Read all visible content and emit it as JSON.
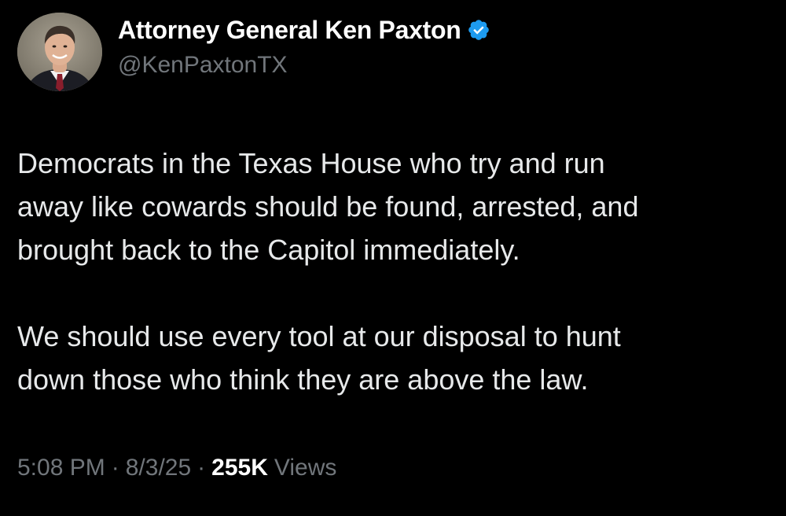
{
  "author": {
    "display_name": "Attorney General Ken Paxton",
    "handle": "@KenPaxtonTX",
    "verified": true,
    "verified_color": "#1d9bf0",
    "avatar_icon": "profile-photo"
  },
  "tweet": {
    "paragraphs": [
      "Democrats in the Texas House who try and run\naway like cowards should be found, arrested, and\nbrought back to the Capitol immediately.",
      "We should use every tool at our disposal to hunt\ndown those who think they are above the law."
    ],
    "time": "5:08 PM",
    "separator": "·",
    "date": "8/3/25",
    "views_count": "255K",
    "views_label": "Views"
  },
  "theme": {
    "background": "#000000",
    "primary_text": "#e7e9ea",
    "secondary_text": "#71767b"
  }
}
